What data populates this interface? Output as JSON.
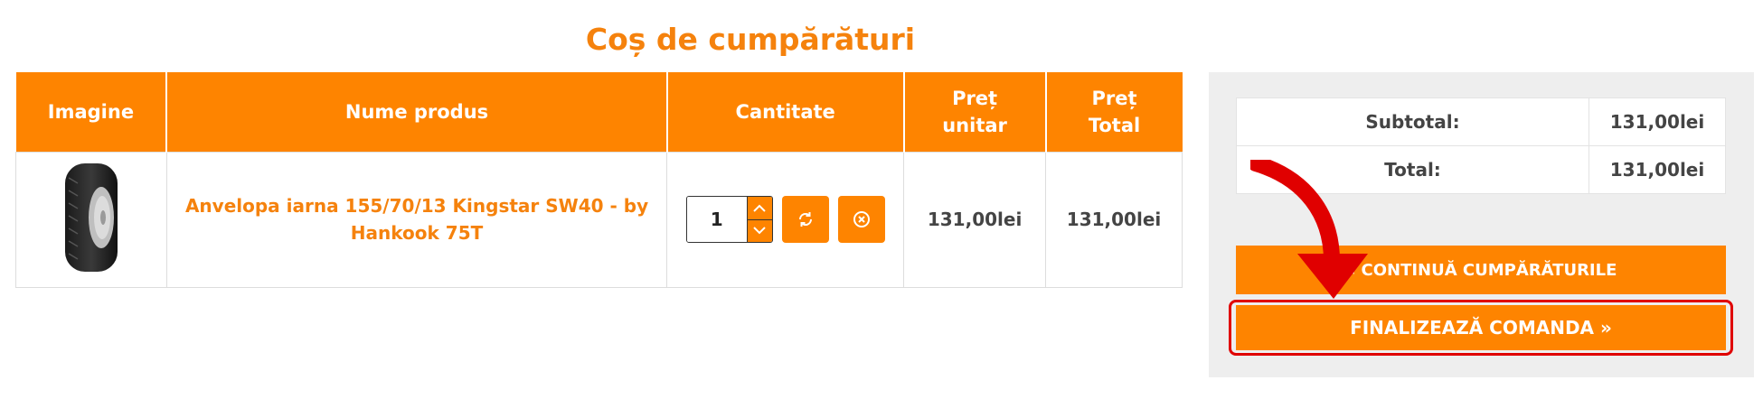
{
  "page": {
    "title": "Coș de cumpărături"
  },
  "cart": {
    "headers": {
      "image": "Imagine",
      "name": "Nume produs",
      "quantity": "Cantitate",
      "unit_price_line1": "Preț",
      "unit_price_line2": "unitar",
      "total_price_line1": "Preț",
      "total_price_line2": "Total"
    },
    "items": [
      {
        "name": "Anvelopa iarna 155/70/13 Kingstar SW40 - by Hankook 75T",
        "quantity": "1",
        "unit_price": "131,00lei",
        "total_price": "131,00lei",
        "image_icon": "tire-icon"
      }
    ]
  },
  "summary": {
    "subtotal_label": "Subtotal:",
    "subtotal_value": "131,00lei",
    "total_label": "Total:",
    "total_value": "131,00lei",
    "continue_label": "« CONTINUĂ CUMPĂRĂTURILE",
    "finalize_label": "FINALIZEAZĂ COMANDA »"
  },
  "colors": {
    "accent": "#fe8400",
    "title": "#f5820d",
    "highlight": "#e00000",
    "panel_bg": "#eeeeee"
  }
}
